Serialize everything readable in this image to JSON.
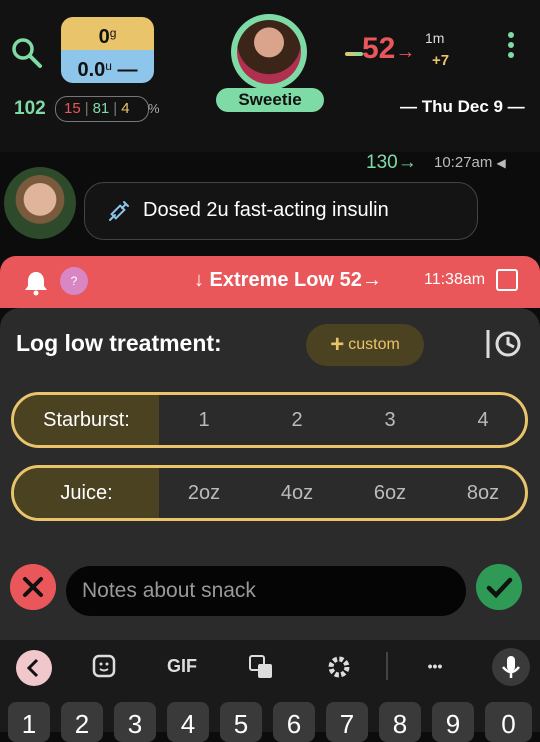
{
  "header": {
    "carbs": {
      "value": "0",
      "unit": "g"
    },
    "insulin": {
      "value": "0.0",
      "unit": "u",
      "suffix": "—"
    },
    "profile_name": "Sweetie",
    "bg_value": "52",
    "bg_arrow": "→",
    "time_ago": "1m",
    "delta": "+7",
    "tir": {
      "avg": "102",
      "low": "15",
      "in_range": "81",
      "high": "4",
      "pct": "%"
    },
    "date": "— Thu Dec 9 —",
    "colors": {
      "green": "#7fdba6",
      "red": "#e9575a",
      "yellow": "#e9c46a",
      "blue": "#8ec5ea"
    }
  },
  "feed": {
    "reading": "130→",
    "time": "10:27am",
    "message": "Dosed 2u fast-acting insulin"
  },
  "alert": {
    "badge": "?",
    "text": "↓ Extreme Low 52→",
    "time": "11:38am"
  },
  "panel": {
    "title": "Log low treatment:",
    "custom_label": "custom",
    "rows": [
      {
        "label": "Starburst:",
        "options": [
          "1",
          "2",
          "3",
          "4"
        ]
      },
      {
        "label": "Juice:",
        "options": [
          "2oz",
          "4oz",
          "6oz",
          "8oz"
        ]
      }
    ],
    "notes_placeholder": "Notes about snack"
  },
  "keyboard": {
    "gif": "GIF",
    "more": "•••",
    "number_keys": [
      "1",
      "2",
      "3",
      "4",
      "5",
      "6",
      "7",
      "8",
      "9",
      "0"
    ]
  }
}
